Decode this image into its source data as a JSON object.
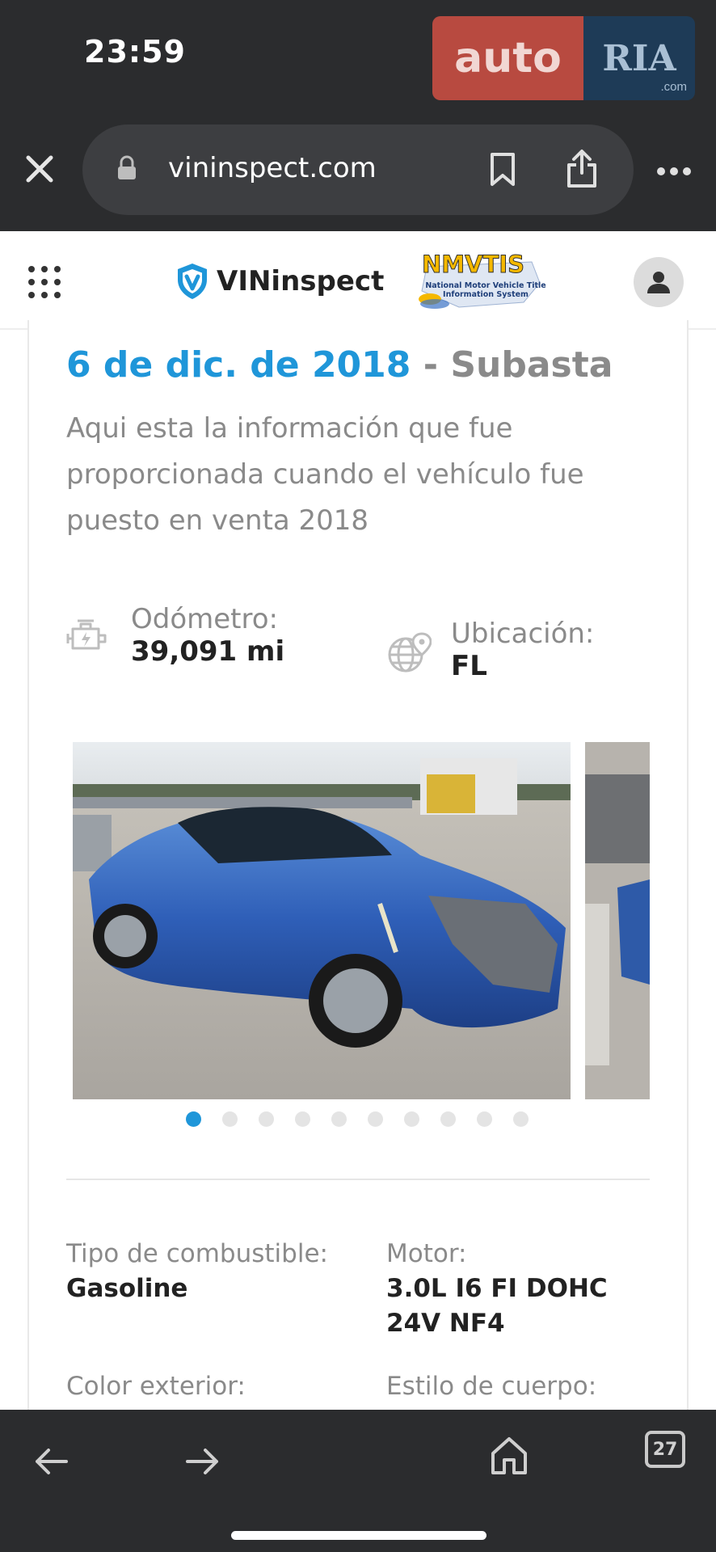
{
  "status_bar": {
    "time": "23:59"
  },
  "watermark": {
    "auto": "auto",
    "ria": "RIA",
    "com": ".com"
  },
  "browser": {
    "url": "vininspect.com",
    "tab_count": "27"
  },
  "site": {
    "logo": "VINinspect",
    "nmvtis_title": "NMVTIS",
    "nmvtis_subtitle": "National Motor Vehicle Title Information System"
  },
  "record": {
    "date": "6 de dic. de 2018",
    "dash": " - ",
    "event": "Subasta",
    "intro": "Aqui esta la información que fue proporcionada cuando el vehículo fue puesto en venta 2018",
    "odometer_label": "Odómetro:",
    "odometer_value": "39,091 mi",
    "location_label": "Ubicación:",
    "location_value": "FL",
    "photo_count": 10,
    "active_photo": 1,
    "specs": {
      "fuel_label": "Tipo de combustible:",
      "fuel_value": "Gasoline",
      "engine_label": "Motor:",
      "engine_value": "3.0L I6 FI DOHC 24V NF4",
      "color_label": "Color exterior:",
      "body_label": "Estilo de cuerpo:"
    }
  },
  "colors": {
    "accent": "#1f96d9",
    "muted": "#8a8a8a",
    "dark_bar": "#2b2c2e"
  }
}
